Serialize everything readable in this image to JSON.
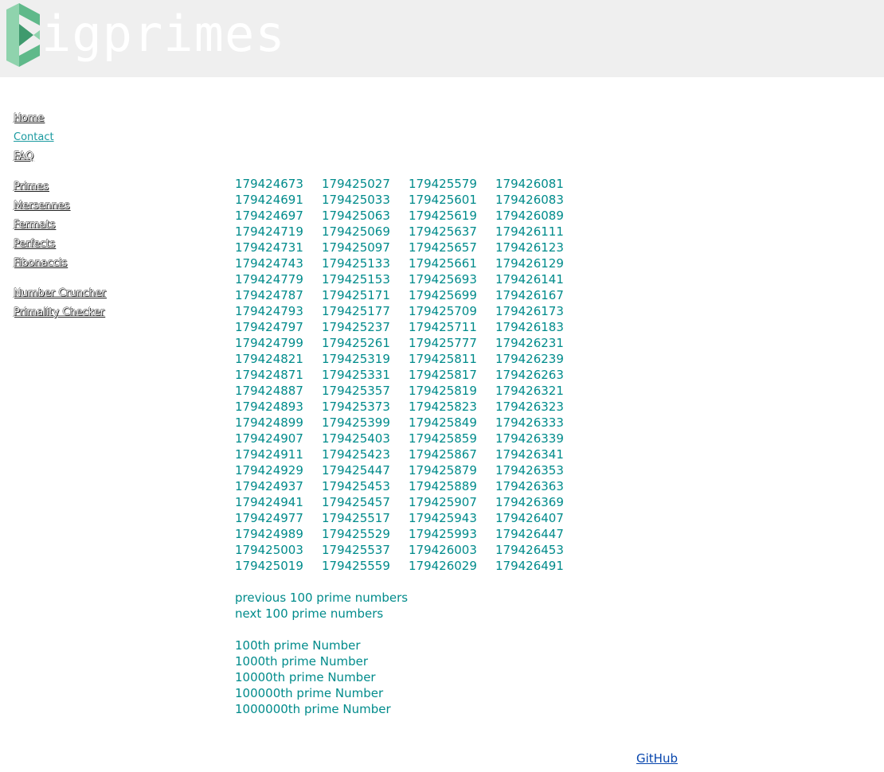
{
  "header": {
    "logo_text": "igprimes",
    "logo_colors": {
      "light": "#8fd3ad",
      "mid": "#5fb98a",
      "dark": "#3f9a6e"
    }
  },
  "sidebar": {
    "group1": [
      {
        "label": "Home"
      },
      {
        "label": "Contact"
      },
      {
        "label": "FAQ"
      }
    ],
    "group2": [
      {
        "label": "Primes"
      },
      {
        "label": "Mersennes"
      },
      {
        "label": "Fermats"
      },
      {
        "label": "Perfects"
      },
      {
        "label": "Fibonaccis"
      }
    ],
    "group3": [
      {
        "label": "Number Cruncher"
      },
      {
        "label": "Primality Checker"
      }
    ]
  },
  "primes": {
    "columns": [
      [
        "179424673",
        "179424691",
        "179424697",
        "179424719",
        "179424731",
        "179424743",
        "179424779",
        "179424787",
        "179424793",
        "179424797",
        "179424799",
        "179424821",
        "179424871",
        "179424887",
        "179424893",
        "179424899",
        "179424907",
        "179424911",
        "179424929",
        "179424937",
        "179424941",
        "179424977",
        "179424989",
        "179425003",
        "179425019"
      ],
      [
        "179425027",
        "179425033",
        "179425063",
        "179425069",
        "179425097",
        "179425133",
        "179425153",
        "179425171",
        "179425177",
        "179425237",
        "179425261",
        "179425319",
        "179425331",
        "179425357",
        "179425373",
        "179425399",
        "179425403",
        "179425423",
        "179425447",
        "179425453",
        "179425457",
        "179425517",
        "179425529",
        "179425537",
        "179425559"
      ],
      [
        "179425579",
        "179425601",
        "179425619",
        "179425637",
        "179425657",
        "179425661",
        "179425693",
        "179425699",
        "179425709",
        "179425711",
        "179425777",
        "179425811",
        "179425817",
        "179425819",
        "179425823",
        "179425849",
        "179425859",
        "179425867",
        "179425879",
        "179425889",
        "179425907",
        "179425943",
        "179425993",
        "179426003",
        "179426029"
      ],
      [
        "179426081",
        "179426083",
        "179426089",
        "179426111",
        "179426123",
        "179426129",
        "179426141",
        "179426167",
        "179426173",
        "179426183",
        "179426231",
        "179426239",
        "179426263",
        "179426321",
        "179426323",
        "179426333",
        "179426339",
        "179426341",
        "179426353",
        "179426363",
        "179426369",
        "179426407",
        "179426447",
        "179426453",
        "179426491"
      ]
    ]
  },
  "navigation": {
    "previous": "previous 100 prime numbers",
    "next": "next 100 prime numbers"
  },
  "nth_links": [
    "100th prime Number",
    "1000th prime Number",
    "10000th prime Number",
    "100000th prime Number",
    "1000000th prime Number"
  ],
  "footer": {
    "github": "GitHub"
  },
  "colors": {
    "header_bg": "#efefef",
    "prime_text": "#008b8b",
    "contact_link": "#1a9aa0",
    "github_link": "#0645ad"
  }
}
